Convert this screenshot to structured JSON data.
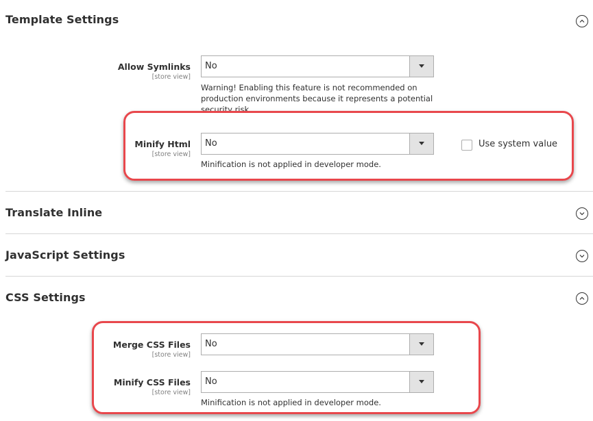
{
  "sections": {
    "template": {
      "title": "Template Settings",
      "state": "expanded",
      "fields": {
        "allow_symlinks": {
          "label": "Allow Symlinks",
          "scope": "[store view]",
          "value": "No",
          "note": "Warning! Enabling this feature is not recommended on production environments because it represents a potential security risk."
        },
        "minify_html": {
          "label": "Minify Html",
          "scope": "[store view]",
          "value": "No",
          "note": "Minification is not applied in developer mode.",
          "use_system_value_label": "Use system value",
          "use_system_value_checked": false
        }
      }
    },
    "translate_inline": {
      "title": "Translate Inline",
      "state": "collapsed"
    },
    "javascript": {
      "title": "JavaScript Settings",
      "state": "collapsed"
    },
    "css": {
      "title": "CSS Settings",
      "state": "expanded",
      "fields": {
        "merge_css": {
          "label": "Merge CSS Files",
          "scope": "[store view]",
          "value": "No"
        },
        "minify_css": {
          "label": "Minify CSS Files",
          "scope": "[store view]",
          "value": "No",
          "note": "Minification is not applied in developer mode."
        }
      }
    }
  },
  "icons": {
    "expanded": "chevron-up-circle",
    "collapsed": "chevron-down-circle",
    "select_arrow": "triangle-down"
  },
  "colors": {
    "highlight": "#e8474c",
    "select_arrow_bg": "#e3e3e3",
    "divider": "#d6d6d6"
  }
}
